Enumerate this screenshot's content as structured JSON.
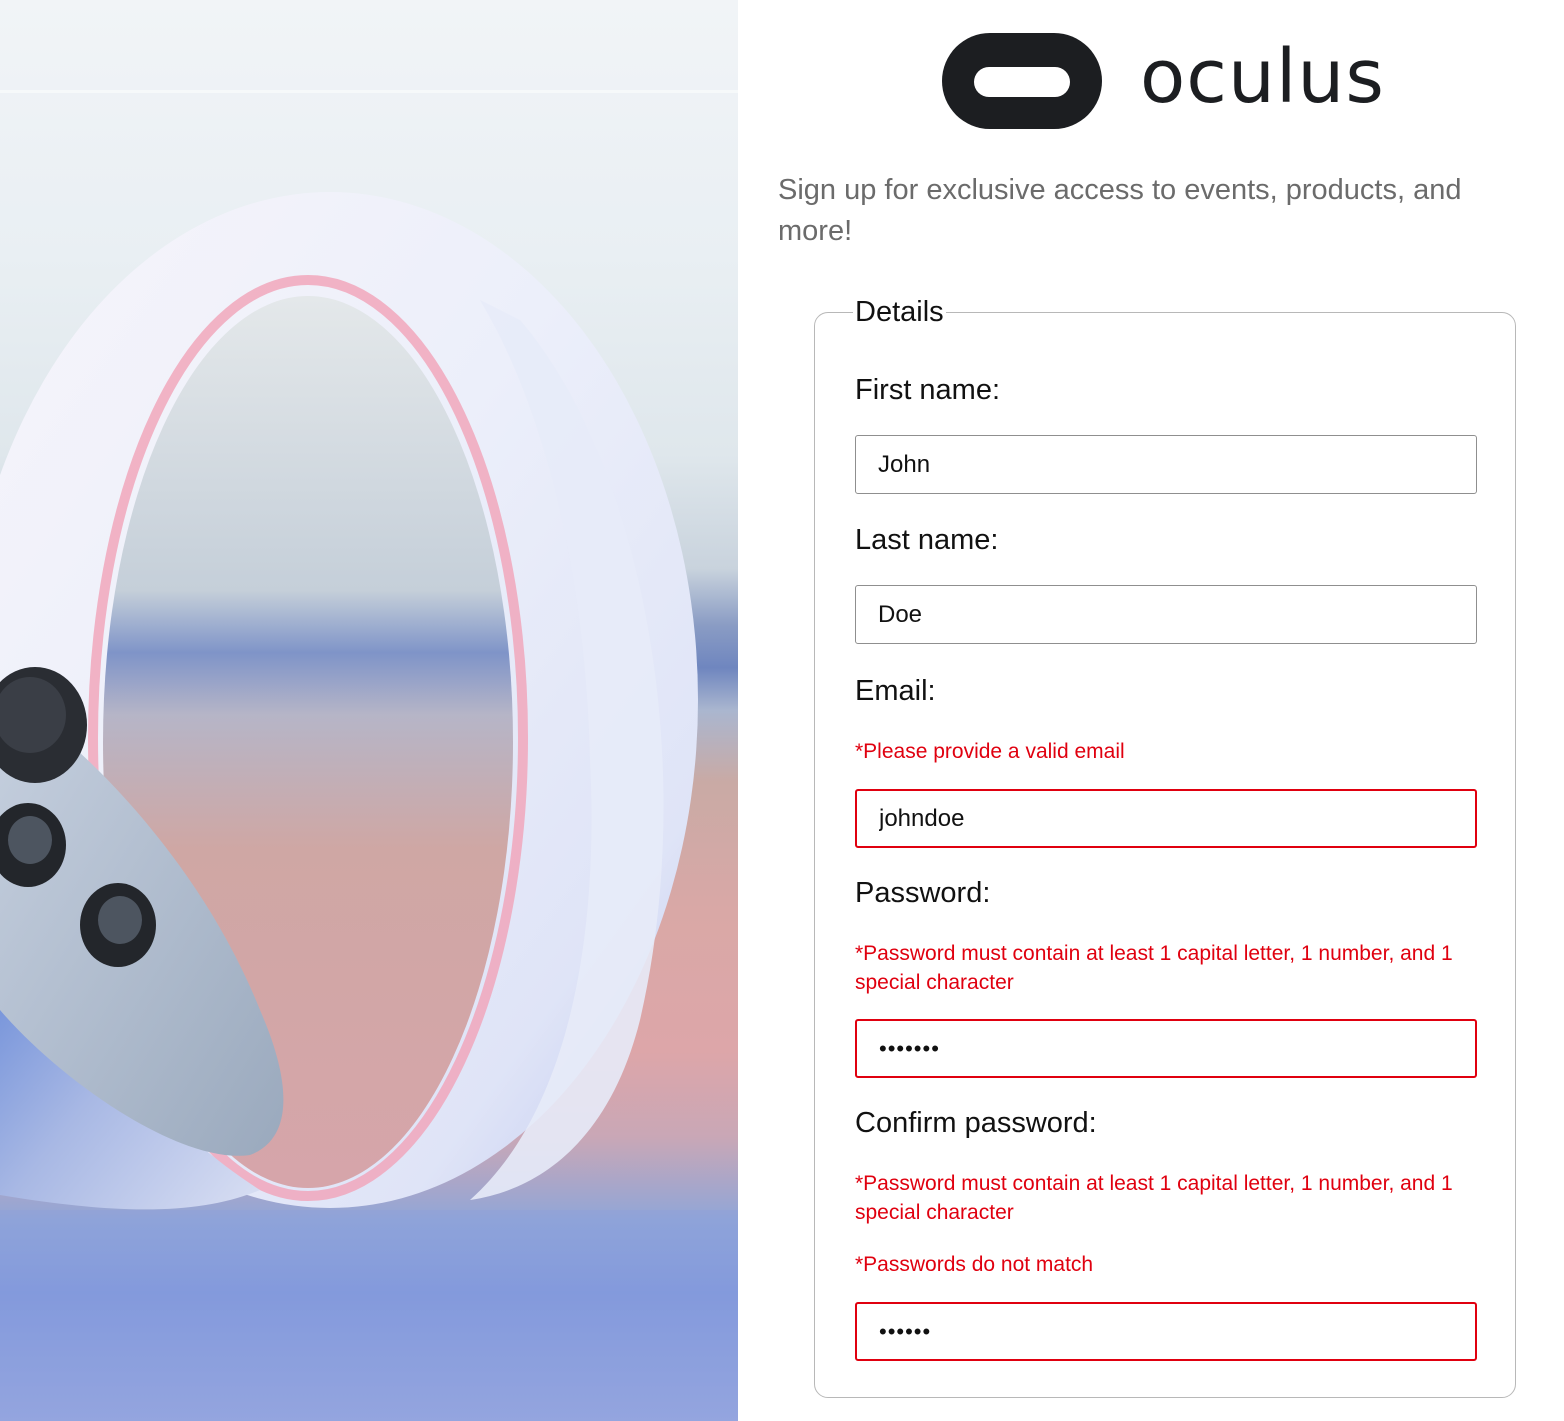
{
  "brand": {
    "name": "oculus"
  },
  "tagline": "Sign up for exclusive access to events, products, and more!",
  "form": {
    "legend": "Details",
    "first_name": {
      "label": "First name:",
      "value": "John"
    },
    "last_name": {
      "label": "Last name:",
      "value": "Doe"
    },
    "email": {
      "label": "Email:",
      "error": "*Please provide a valid email",
      "value": "johndoe"
    },
    "password": {
      "label": "Password:",
      "error": "*Password must contain at least 1 capital letter, 1 number, and 1 special character",
      "value": "•••••••"
    },
    "confirm_password": {
      "label": "Confirm password:",
      "error": "*Password must contain at least 1 capital letter, 1 number, and 1 special character",
      "error_match": "*Passwords do not match",
      "value": "••••••"
    }
  },
  "colors": {
    "error": "#e0000f",
    "brand_dark": "#1c1e21",
    "tagline": "#6b6b6b"
  }
}
